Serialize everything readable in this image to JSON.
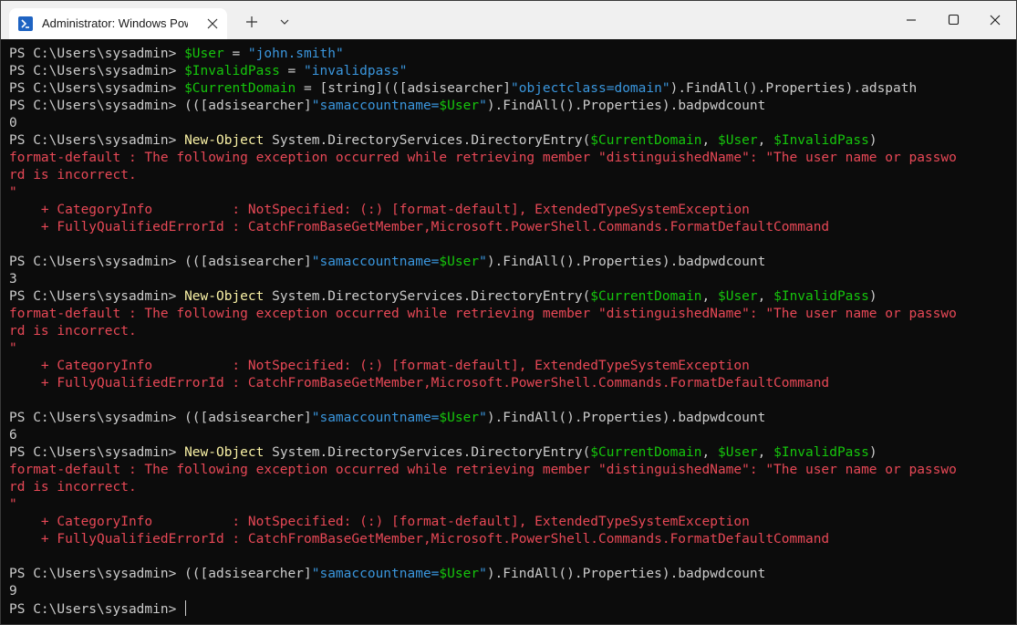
{
  "window": {
    "tab_title": "Administrator: Windows PowerShell",
    "icons": {
      "tab": "powershell-icon",
      "close_tab": "close-icon",
      "new_tab": "plus-icon",
      "dropdown": "chevron-down-icon",
      "minimize": "minimize-icon",
      "maximize": "maximize-icon",
      "close": "close-icon"
    }
  },
  "colors": {
    "background": "#0c0c0c",
    "text": "#cccccc",
    "command": "#f9f1a5",
    "variable": "#16c60c",
    "string": "#3a96dd",
    "error": "#e74856"
  },
  "terminal": {
    "lines": [
      [
        [
          "PS C:\\Users\\sysadmin> ",
          "t"
        ],
        [
          "$User",
          "v"
        ],
        [
          " = ",
          "t"
        ],
        [
          "\"john.smith\"",
          "s"
        ]
      ],
      [
        [
          "PS C:\\Users\\sysadmin> ",
          "t"
        ],
        [
          "$InvalidPass",
          "v"
        ],
        [
          " = ",
          "t"
        ],
        [
          "\"invalidpass\"",
          "s"
        ]
      ],
      [
        [
          "PS C:\\Users\\sysadmin> ",
          "t"
        ],
        [
          "$CurrentDomain",
          "v"
        ],
        [
          " = [string](([adsisearcher]",
          "t"
        ],
        [
          "\"objectclass=domain\"",
          "s"
        ],
        [
          ").FindAll().Properties).adspath",
          "t"
        ]
      ],
      [
        [
          "PS C:\\Users\\sysadmin> (([adsisearcher]",
          "t"
        ],
        [
          "\"samaccountname=",
          "s"
        ],
        [
          "$User",
          "v"
        ],
        [
          "\"",
          "s"
        ],
        [
          ").FindAll().Properties).badpwdcount",
          "t"
        ]
      ],
      [
        [
          "0",
          "t"
        ]
      ],
      [
        [
          "PS C:\\Users\\sysadmin> ",
          "t"
        ],
        [
          "New-Object",
          "k"
        ],
        [
          " System.DirectoryServices.DirectoryEntry(",
          "t"
        ],
        [
          "$CurrentDomain",
          "v"
        ],
        [
          ", ",
          "t"
        ],
        [
          "$User",
          "v"
        ],
        [
          ", ",
          "t"
        ],
        [
          "$InvalidPass",
          "v"
        ],
        [
          ")",
          "t"
        ]
      ],
      [
        [
          "format-default : The following exception occurred while retrieving member \"distinguishedName\": \"The user name or passwo",
          "e"
        ]
      ],
      [
        [
          "rd is incorrect.",
          "e"
        ]
      ],
      [
        [
          "\"",
          "e"
        ]
      ],
      [
        [
          "    + CategoryInfo          : NotSpecified: (:) [format-default], ExtendedTypeSystemException",
          "e"
        ]
      ],
      [
        [
          "    + FullyQualifiedErrorId : CatchFromBaseGetMember,Microsoft.PowerShell.Commands.FormatDefaultCommand",
          "e"
        ]
      ],
      [],
      [
        [
          "PS C:\\Users\\sysadmin> (([adsisearcher]",
          "t"
        ],
        [
          "\"samaccountname=",
          "s"
        ],
        [
          "$User",
          "v"
        ],
        [
          "\"",
          "s"
        ],
        [
          ").FindAll().Properties).badpwdcount",
          "t"
        ]
      ],
      [
        [
          "3",
          "t"
        ]
      ],
      [
        [
          "PS C:\\Users\\sysadmin> ",
          "t"
        ],
        [
          "New-Object",
          "k"
        ],
        [
          " System.DirectoryServices.DirectoryEntry(",
          "t"
        ],
        [
          "$CurrentDomain",
          "v"
        ],
        [
          ", ",
          "t"
        ],
        [
          "$User",
          "v"
        ],
        [
          ", ",
          "t"
        ],
        [
          "$InvalidPass",
          "v"
        ],
        [
          ")",
          "t"
        ]
      ],
      [
        [
          "format-default : The following exception occurred while retrieving member \"distinguishedName\": \"The user name or passwo",
          "e"
        ]
      ],
      [
        [
          "rd is incorrect.",
          "e"
        ]
      ],
      [
        [
          "\"",
          "e"
        ]
      ],
      [
        [
          "    + CategoryInfo          : NotSpecified: (:) [format-default], ExtendedTypeSystemException",
          "e"
        ]
      ],
      [
        [
          "    + FullyQualifiedErrorId : CatchFromBaseGetMember,Microsoft.PowerShell.Commands.FormatDefaultCommand",
          "e"
        ]
      ],
      [],
      [
        [
          "PS C:\\Users\\sysadmin> (([adsisearcher]",
          "t"
        ],
        [
          "\"samaccountname=",
          "s"
        ],
        [
          "$User",
          "v"
        ],
        [
          "\"",
          "s"
        ],
        [
          ").FindAll().Properties).badpwdcount",
          "t"
        ]
      ],
      [
        [
          "6",
          "t"
        ]
      ],
      [
        [
          "PS C:\\Users\\sysadmin> ",
          "t"
        ],
        [
          "New-Object",
          "k"
        ],
        [
          " System.DirectoryServices.DirectoryEntry(",
          "t"
        ],
        [
          "$CurrentDomain",
          "v"
        ],
        [
          ", ",
          "t"
        ],
        [
          "$User",
          "v"
        ],
        [
          ", ",
          "t"
        ],
        [
          "$InvalidPass",
          "v"
        ],
        [
          ")",
          "t"
        ]
      ],
      [
        [
          "format-default : The following exception occurred while retrieving member \"distinguishedName\": \"The user name or passwo",
          "e"
        ]
      ],
      [
        [
          "rd is incorrect.",
          "e"
        ]
      ],
      [
        [
          "\"",
          "e"
        ]
      ],
      [
        [
          "    + CategoryInfo          : NotSpecified: (:) [format-default], ExtendedTypeSystemException",
          "e"
        ]
      ],
      [
        [
          "    + FullyQualifiedErrorId : CatchFromBaseGetMember,Microsoft.PowerShell.Commands.FormatDefaultCommand",
          "e"
        ]
      ],
      [],
      [
        [
          "PS C:\\Users\\sysadmin> (([adsisearcher]",
          "t"
        ],
        [
          "\"samaccountname=",
          "s"
        ],
        [
          "$User",
          "v"
        ],
        [
          "\"",
          "s"
        ],
        [
          ").FindAll().Properties).badpwdcount",
          "t"
        ]
      ],
      [
        [
          "9",
          "t"
        ]
      ],
      [
        [
          "PS C:\\Users\\sysadmin> ",
          "t"
        ]
      ]
    ]
  }
}
